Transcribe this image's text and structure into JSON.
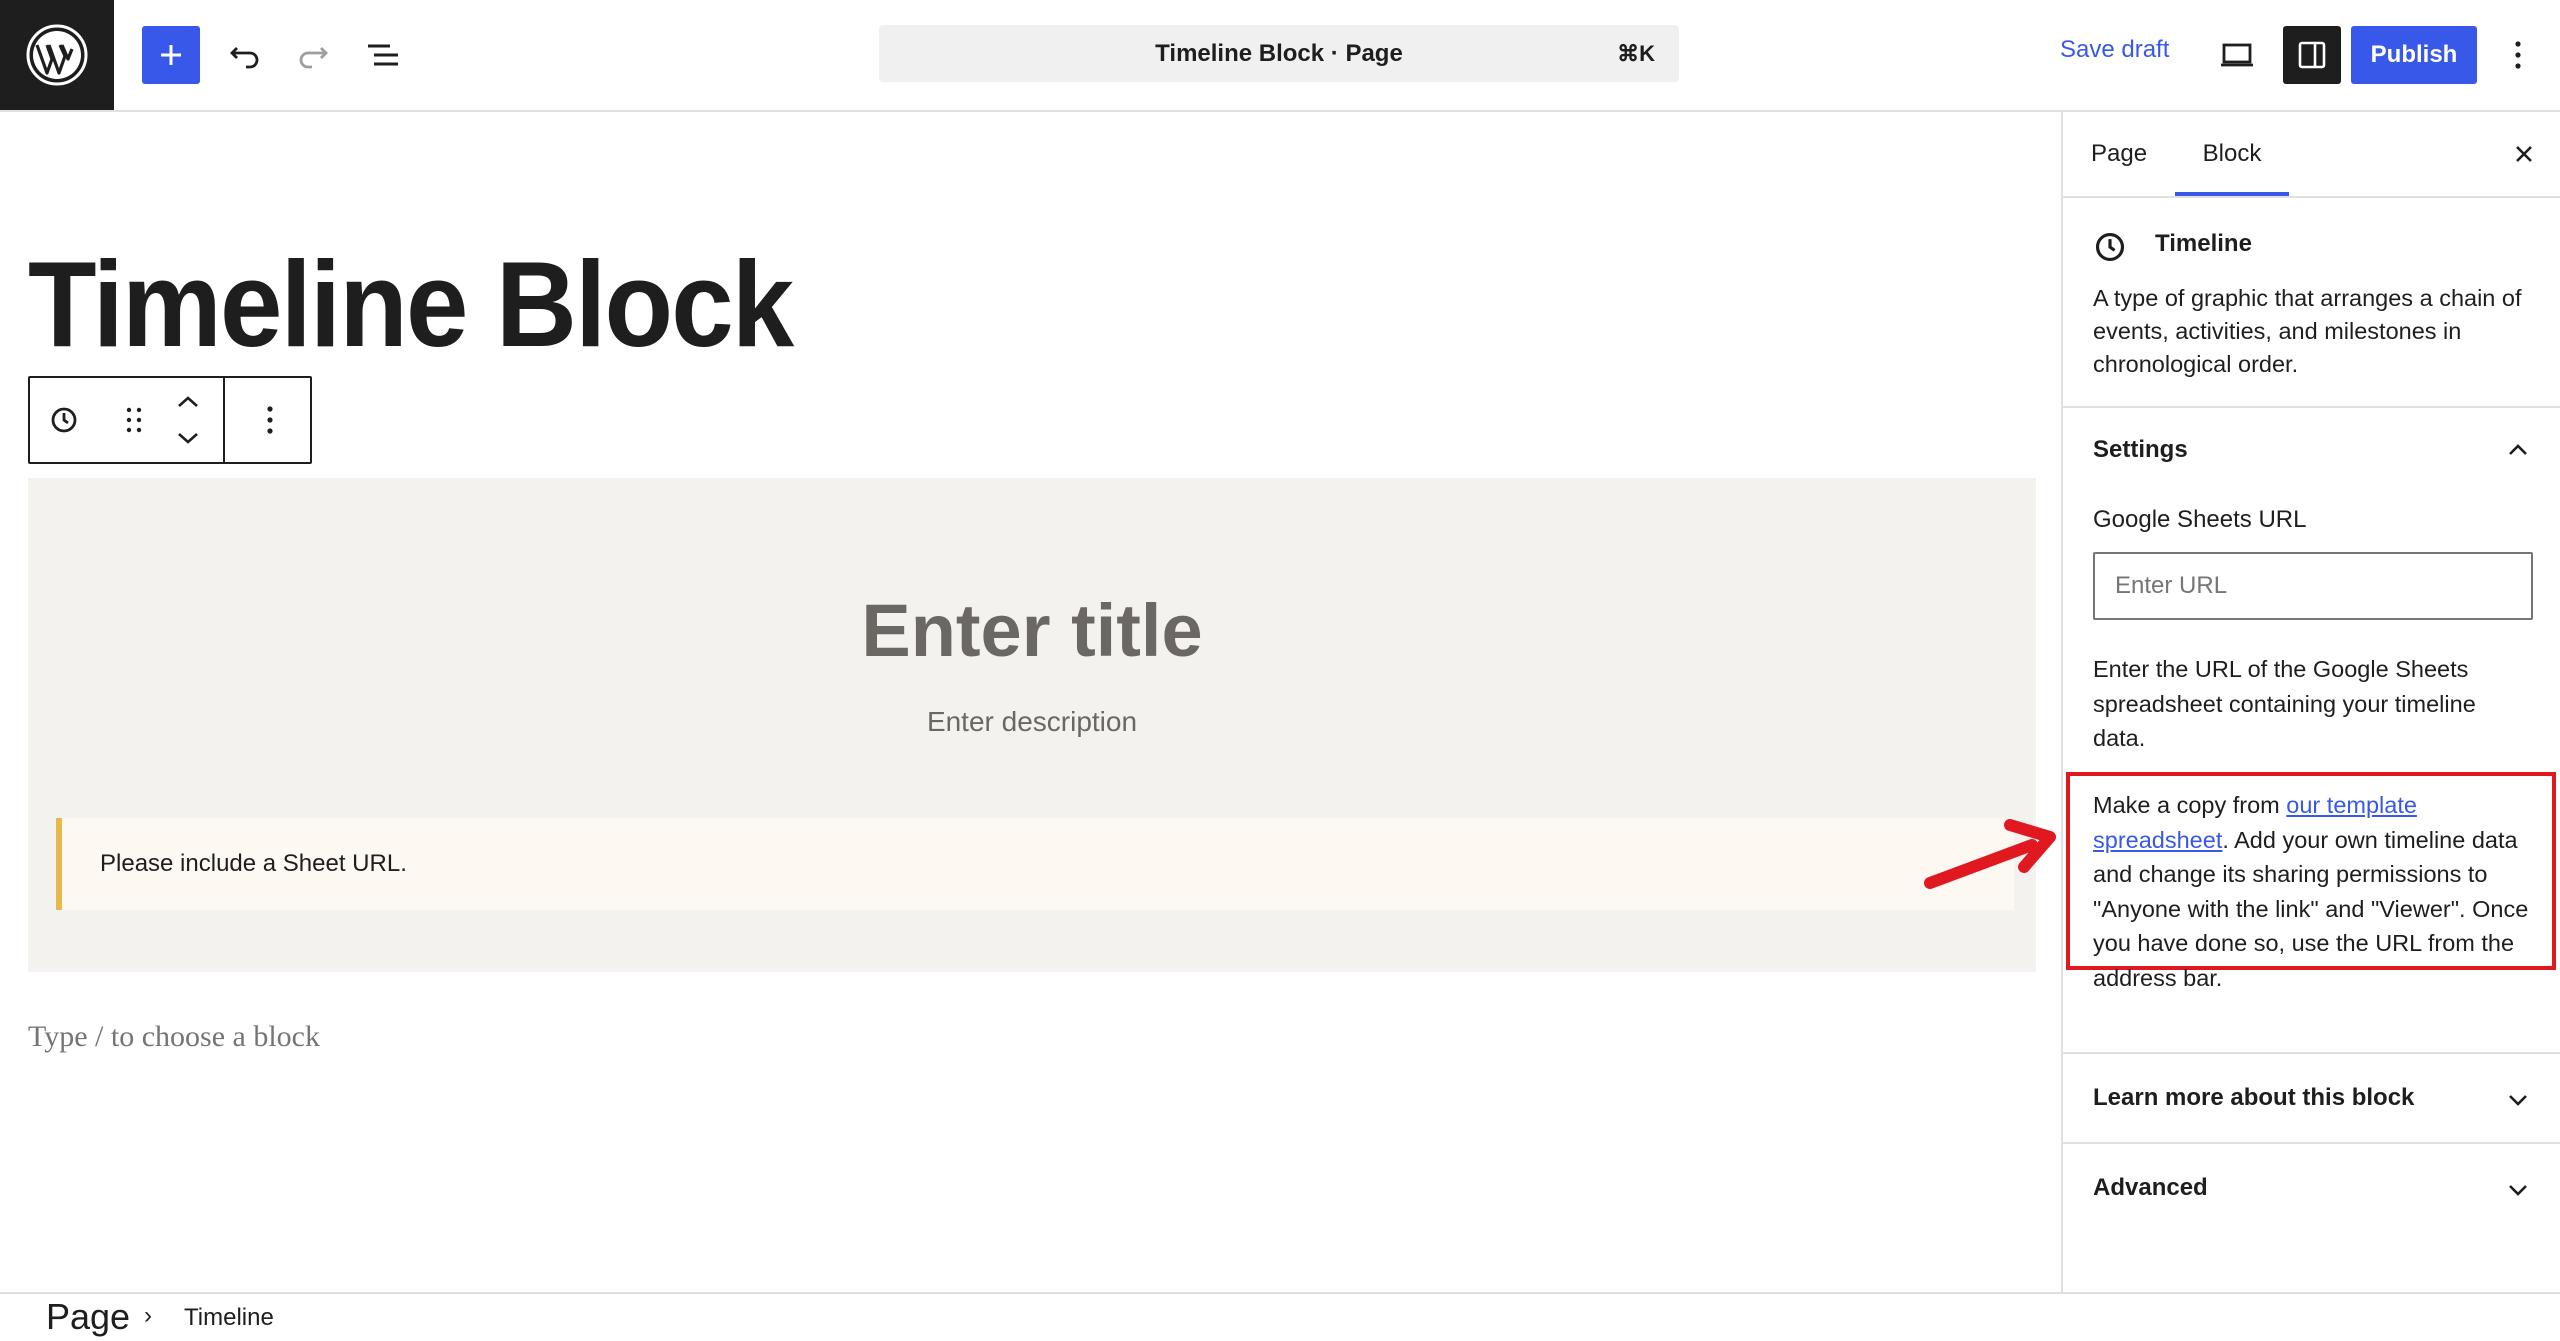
{
  "header": {
    "document_title": "Timeline Block · Page",
    "command_shortcut": "⌘K",
    "save_draft_label": "Save draft",
    "publish_label": "Publish",
    "accent_color": "#3858e9"
  },
  "editor": {
    "post_title": "Timeline Block",
    "timeline_block": {
      "title_placeholder": "Enter title",
      "description_placeholder": "Enter description",
      "notice": "Please include a Sheet URL."
    },
    "appender_placeholder": "Type / to choose a block"
  },
  "sidebar": {
    "tabs": [
      {
        "label": "Page",
        "active": false
      },
      {
        "label": "Block",
        "active": true
      }
    ],
    "block_card": {
      "name": "Timeline",
      "description": "A type of graphic that arranges a chain of events, activities, and milestones in chronological order."
    },
    "settings": {
      "heading": "Settings",
      "url_label": "Google Sheets URL",
      "url_placeholder": "Enter URL",
      "help_text": "Enter the URL of the Google Sheets spreadsheet containing your timeline data.",
      "copy_prefix": "Make a copy from ",
      "copy_link": "our template spreadsheet",
      "copy_suffix": ". Add your own timeline data and change its sharing permissions to \"Anyone with the link\" and \"Viewer\". Once you have done so, use the URL from the address bar."
    },
    "panels": [
      {
        "label": "Learn more about this block",
        "expanded": false
      },
      {
        "label": "Advanced",
        "expanded": false
      }
    ]
  },
  "footer": {
    "breadcrumb_root": "Page",
    "breadcrumb_current": "Timeline"
  }
}
